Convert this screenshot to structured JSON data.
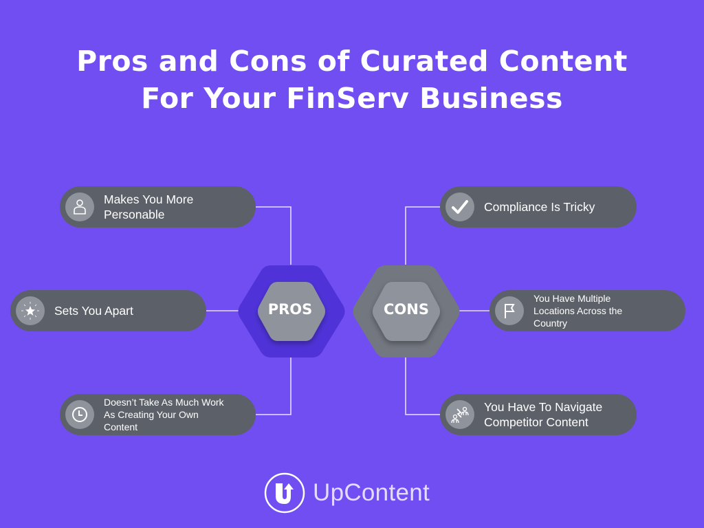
{
  "title": {
    "line1": "Pros and Cons of Curated Content",
    "line2": "For Your FinServ Business"
  },
  "colors": {
    "background": "#714ef2",
    "pill": "#5c6068",
    "icon_circle": "#8f939b",
    "pros_outer_hex": "#4f33d9",
    "cons_outer_hex": "#737780",
    "inner_hex": "#8f939b",
    "connector": "#e6e0ff"
  },
  "hubs": {
    "pros": "PROS",
    "cons": "CONS"
  },
  "pros": [
    {
      "label": "Makes You More\nPersonable",
      "icon": "person-icon"
    },
    {
      "label": "Sets You Apart",
      "icon": "star-burst-icon"
    },
    {
      "label": "Doesn’t Take As Much Work\nAs Creating Your Own\nContent",
      "icon": "clock-icon"
    }
  ],
  "cons": [
    {
      "label": "Compliance Is Tricky",
      "icon": "checkmark-icon"
    },
    {
      "label": "You Have Multiple\nLocations Across the\nCountry",
      "icon": "flag-icon"
    },
    {
      "label": "You Have To Navigate\nCompetitor Content",
      "icon": "competitors-icon"
    }
  ],
  "logo": {
    "text": "UpContent",
    "icon": "upcontent-logo-icon"
  }
}
